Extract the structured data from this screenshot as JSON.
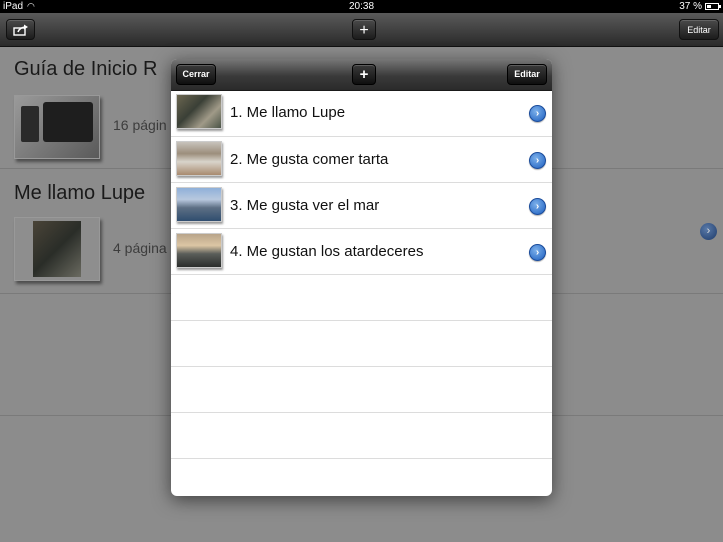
{
  "status_bar": {
    "device": "iPad",
    "time": "20:38",
    "battery": "37 %",
    "battery_level": 0.37
  },
  "toolbar": {
    "add_label": "+",
    "edit_label": "Editar"
  },
  "background_list": {
    "books": [
      {
        "title": "Guía de Inicio R",
        "count": "16 págin"
      },
      {
        "title": "Me llamo Lupe",
        "count": "4 página"
      }
    ]
  },
  "popover": {
    "close_label": "Cerrar",
    "add_label": "+",
    "edit_label": "Editar",
    "pages": [
      {
        "label": "1. Me llamo Lupe"
      },
      {
        "label": "2. Me gusta comer tarta"
      },
      {
        "label": "3. Me gusta ver el mar"
      },
      {
        "label": "4. Me gustan los atardeceres"
      }
    ],
    "disclosure_glyph": "›"
  }
}
